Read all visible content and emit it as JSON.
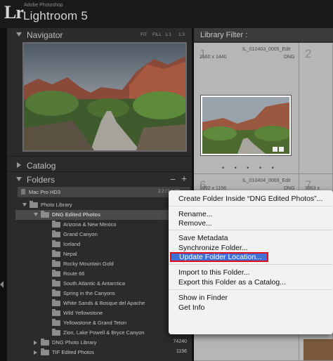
{
  "app": {
    "brand_mark": "Lr",
    "vendor": "Adobe Photoshop",
    "name": "Lightroom 5"
  },
  "navigator": {
    "title": "Navigator",
    "zoom_options": [
      "FIT",
      "FILL",
      "1:1",
      "1:3"
    ]
  },
  "catalog": {
    "title": "Catalog"
  },
  "folders": {
    "title": "Folders",
    "plus": "+",
    "minus": "−",
    "volume": {
      "name": "Mac Pro HD3",
      "size": "2.2 / 3.6 TB"
    },
    "rows": [
      {
        "label": "Photo Library",
        "count": "76552",
        "level": 1,
        "expanded": true
      },
      {
        "label": "DNG Edited Photos",
        "count": "",
        "level": 2,
        "expanded": true,
        "selected": true
      },
      {
        "label": "Arizona & New Mexico",
        "count": "",
        "level": 3
      },
      {
        "label": "Grand Canyon",
        "count": "",
        "level": 3
      },
      {
        "label": "Iceland",
        "count": "",
        "level": 3
      },
      {
        "label": "Nepal",
        "count": "",
        "level": 3
      },
      {
        "label": "Rocky Mountain Gold",
        "count": "",
        "level": 3
      },
      {
        "label": "Route 66",
        "count": "",
        "level": 3
      },
      {
        "label": "South Atlantic & Antarctica",
        "count": "",
        "level": 3
      },
      {
        "label": "Spring in the Canyons",
        "count": "",
        "level": 3
      },
      {
        "label": "White Sands & Bosque del Apache",
        "count": "",
        "level": 3
      },
      {
        "label": "Wild Yellowstone",
        "count": "",
        "level": 3
      },
      {
        "label": "Yellowstone & Grand Teton",
        "count": "",
        "level": 3
      },
      {
        "label": "Zion, Lake Powell & Bryce Canyon",
        "count": "",
        "level": 3
      },
      {
        "label": "DNG Photo Library",
        "count": "74240",
        "level": 2,
        "expanded": false
      },
      {
        "label": "TIF Edited Photos",
        "count": "1156",
        "level": 2,
        "expanded": false
      }
    ]
  },
  "library_filter": {
    "label": "Library Filter :"
  },
  "grid": {
    "cells": [
      {
        "index": "1",
        "name": "IL_010403_0005_Edit",
        "dims": "2160 x 1440",
        "ext": "DNG"
      },
      {
        "index": "2",
        "name": "",
        "dims": "",
        "ext": ""
      },
      {
        "index": "6",
        "name": "IL_010404_0069_Edit",
        "dims": "1992 x 1156",
        "ext": "DNG"
      },
      {
        "index": "7",
        "name": "",
        "dims": "1963 x",
        "ext": ""
      }
    ],
    "dots": "• • • • •"
  },
  "context_menu": {
    "items": [
      {
        "label": "Create Folder Inside “DNG Edited Photos”...",
        "group": 0
      },
      {
        "label": "Rename...",
        "group": 1
      },
      {
        "label": "Remove...",
        "group": 1
      },
      {
        "label": "Save Metadata",
        "group": 2
      },
      {
        "label": "Synchronize Folder...",
        "group": 2
      },
      {
        "label": "Update Folder Location...",
        "group": 2,
        "highlighted": true
      },
      {
        "label": "Import to this Folder...",
        "group": 3
      },
      {
        "label": "Export this Folder as a Catalog...",
        "group": 3
      },
      {
        "label": "Show in Finder",
        "group": 4
      },
      {
        "label": "Get Info",
        "group": 4
      }
    ]
  },
  "colors": {
    "highlight": "#3f6fd6",
    "annotation": "#e0101a",
    "panel": "#2b2b2b"
  }
}
